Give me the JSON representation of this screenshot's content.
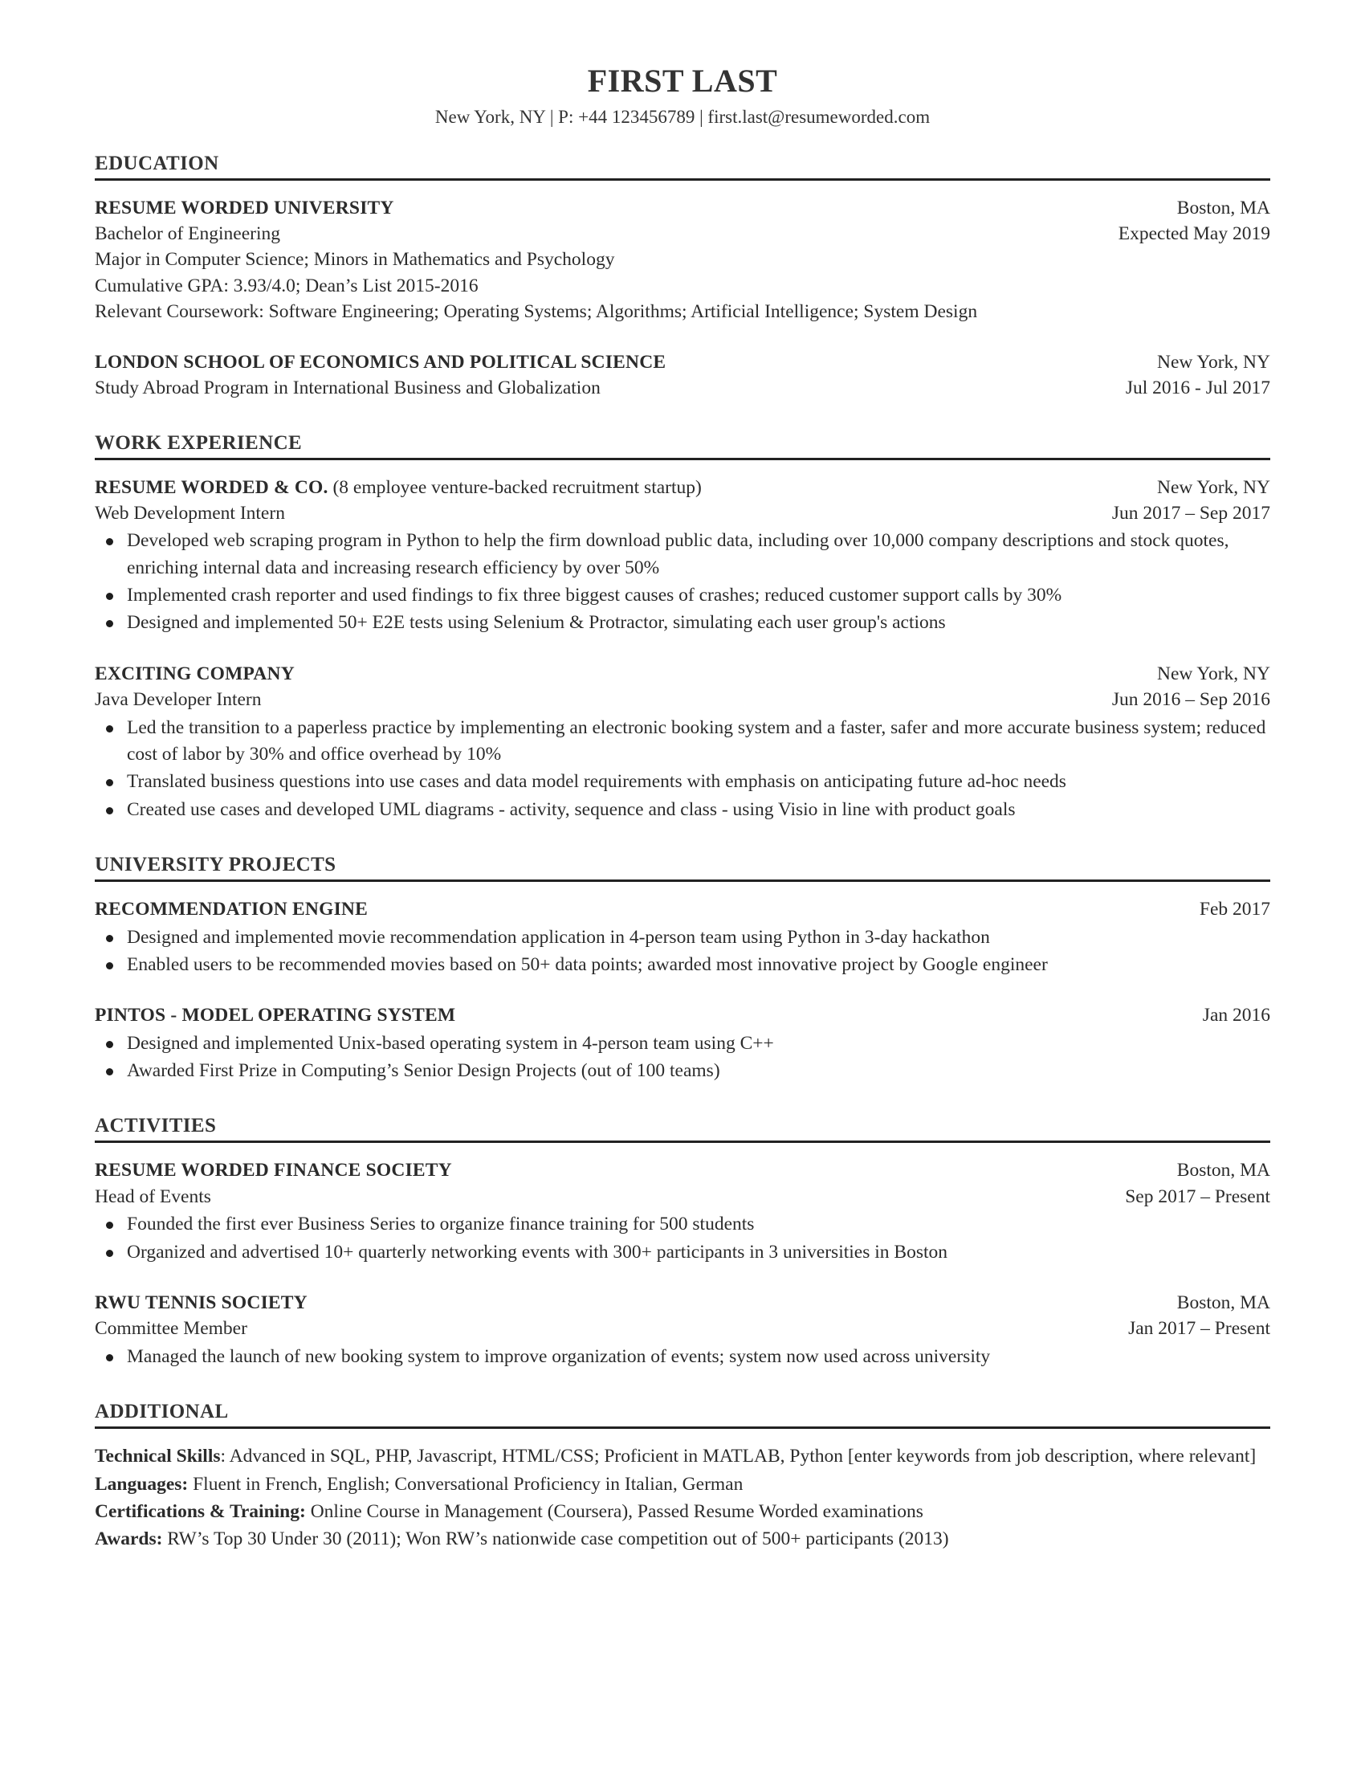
{
  "header": {
    "name": "FIRST LAST",
    "contact": "New York, NY | P: +44 123456789 | first.last@resumeworded.com"
  },
  "sections": {
    "education": {
      "title": "EDUCATION",
      "entries": [
        {
          "org": "RESUME WORDED UNIVERSITY",
          "location": "Boston, MA",
          "role": "Bachelor of Engineering",
          "dates": "Expected May 2019",
          "details": [
            "Major in Computer Science; Minors in Mathematics and Psychology",
            "Cumulative GPA: 3.93/4.0; Dean’s List 2015-2016",
            "Relevant Coursework: Software Engineering; Operating Systems; Algorithms; Artificial Intelligence; System Design"
          ]
        },
        {
          "org": "LONDON SCHOOL OF ECONOMICS AND POLITICAL SCIENCE",
          "location": "New York, NY",
          "role": "Study Abroad Program in International Business and Globalization",
          "dates": "Jul 2016 - Jul 2017",
          "details": []
        }
      ]
    },
    "work": {
      "title": "WORK EXPERIENCE",
      "entries": [
        {
          "org": "RESUME WORDED & CO.",
          "org_note": "(8 employee venture-backed recruitment startup)",
          "location": "New York, NY",
          "role": "Web Development Intern",
          "dates": "Jun 2017 – Sep 2017",
          "bullets": [
            "Developed web scraping program in Python to help the firm download public data, including over 10,000 company descriptions and stock quotes, enriching internal data and increasing research efficiency by over 50%",
            "Implemented crash reporter and used findings to fix three biggest causes of crashes; reduced customer support calls by 30%",
            "Designed and implemented 50+ E2E tests using Selenium & Protractor, simulating each user group's actions"
          ]
        },
        {
          "org": "EXCITING COMPANY",
          "org_note": "",
          "location": "New York, NY",
          "role": "Java Developer Intern",
          "dates": "Jun 2016 – Sep 2016",
          "bullets": [
            "Led the transition to a paperless practice by implementing an electronic booking system and a faster, safer and more accurate business system; reduced cost of labor by 30% and office overhead by 10%",
            "Translated business questions into use cases and data model requirements with emphasis on anticipating future ad-hoc needs",
            "Created use cases and developed UML diagrams - activity, sequence and class - using Visio in line with product goals"
          ]
        }
      ]
    },
    "projects": {
      "title": "UNIVERSITY PROJECTS",
      "entries": [
        {
          "org": "RECOMMENDATION ENGINE",
          "dates": "Feb 2017",
          "bullets": [
            "Designed and implemented movie recommendation application in 4-person team using Python in 3-day hackathon",
            "Enabled users to be recommended movies based on 50+ data points; awarded most innovative project by Google engineer"
          ]
        },
        {
          "org": "PINTOS - MODEL OPERATING SYSTEM",
          "dates": "Jan 2016",
          "bullets": [
            "Designed and implemented Unix-based operating system in 4-person team using C++",
            "Awarded First Prize in Computing’s Senior Design Projects (out of 100 teams)"
          ]
        }
      ]
    },
    "activities": {
      "title": "ACTIVITIES",
      "entries": [
        {
          "org": "RESUME WORDED FINANCE SOCIETY",
          "location": "Boston, MA",
          "role": "Head of Events",
          "dates": "Sep 2017 – Present",
          "bullets": [
            "Founded the first ever Business Series to organize finance training for 500 students",
            "Organized and advertised 10+ quarterly networking events with 300+ participants in 3 universities in Boston"
          ]
        },
        {
          "org": "RWU TENNIS SOCIETY",
          "location": "Boston, MA",
          "role": "Committee Member",
          "dates": "Jan 2017 – Present",
          "bullets": [
            "Managed the launch of new booking system to improve organization of events; system now used across university"
          ]
        }
      ]
    },
    "additional": {
      "title": "ADDITIONAL",
      "lines": [
        {
          "label": "Technical Skills",
          "separator": ":",
          "text": " Advanced in SQL, PHP, Javascript, HTML/CSS; Proficient in MATLAB, Python [enter keywords from job description, where relevant]"
        },
        {
          "label": "Languages:",
          "separator": "",
          "text": " Fluent in French, English; Conversational Proficiency in Italian, German"
        },
        {
          "label": "Certifications & Training:",
          "separator": "",
          "text": " Online Course in Management (Coursera), Passed Resume Worded examinations"
        },
        {
          "label": "Awards:",
          "separator": "",
          "text": " RW’s Top 30 Under 30 (2011); Won RW’s nationwide case competition out of 500+ participants (2013)"
        }
      ]
    }
  }
}
